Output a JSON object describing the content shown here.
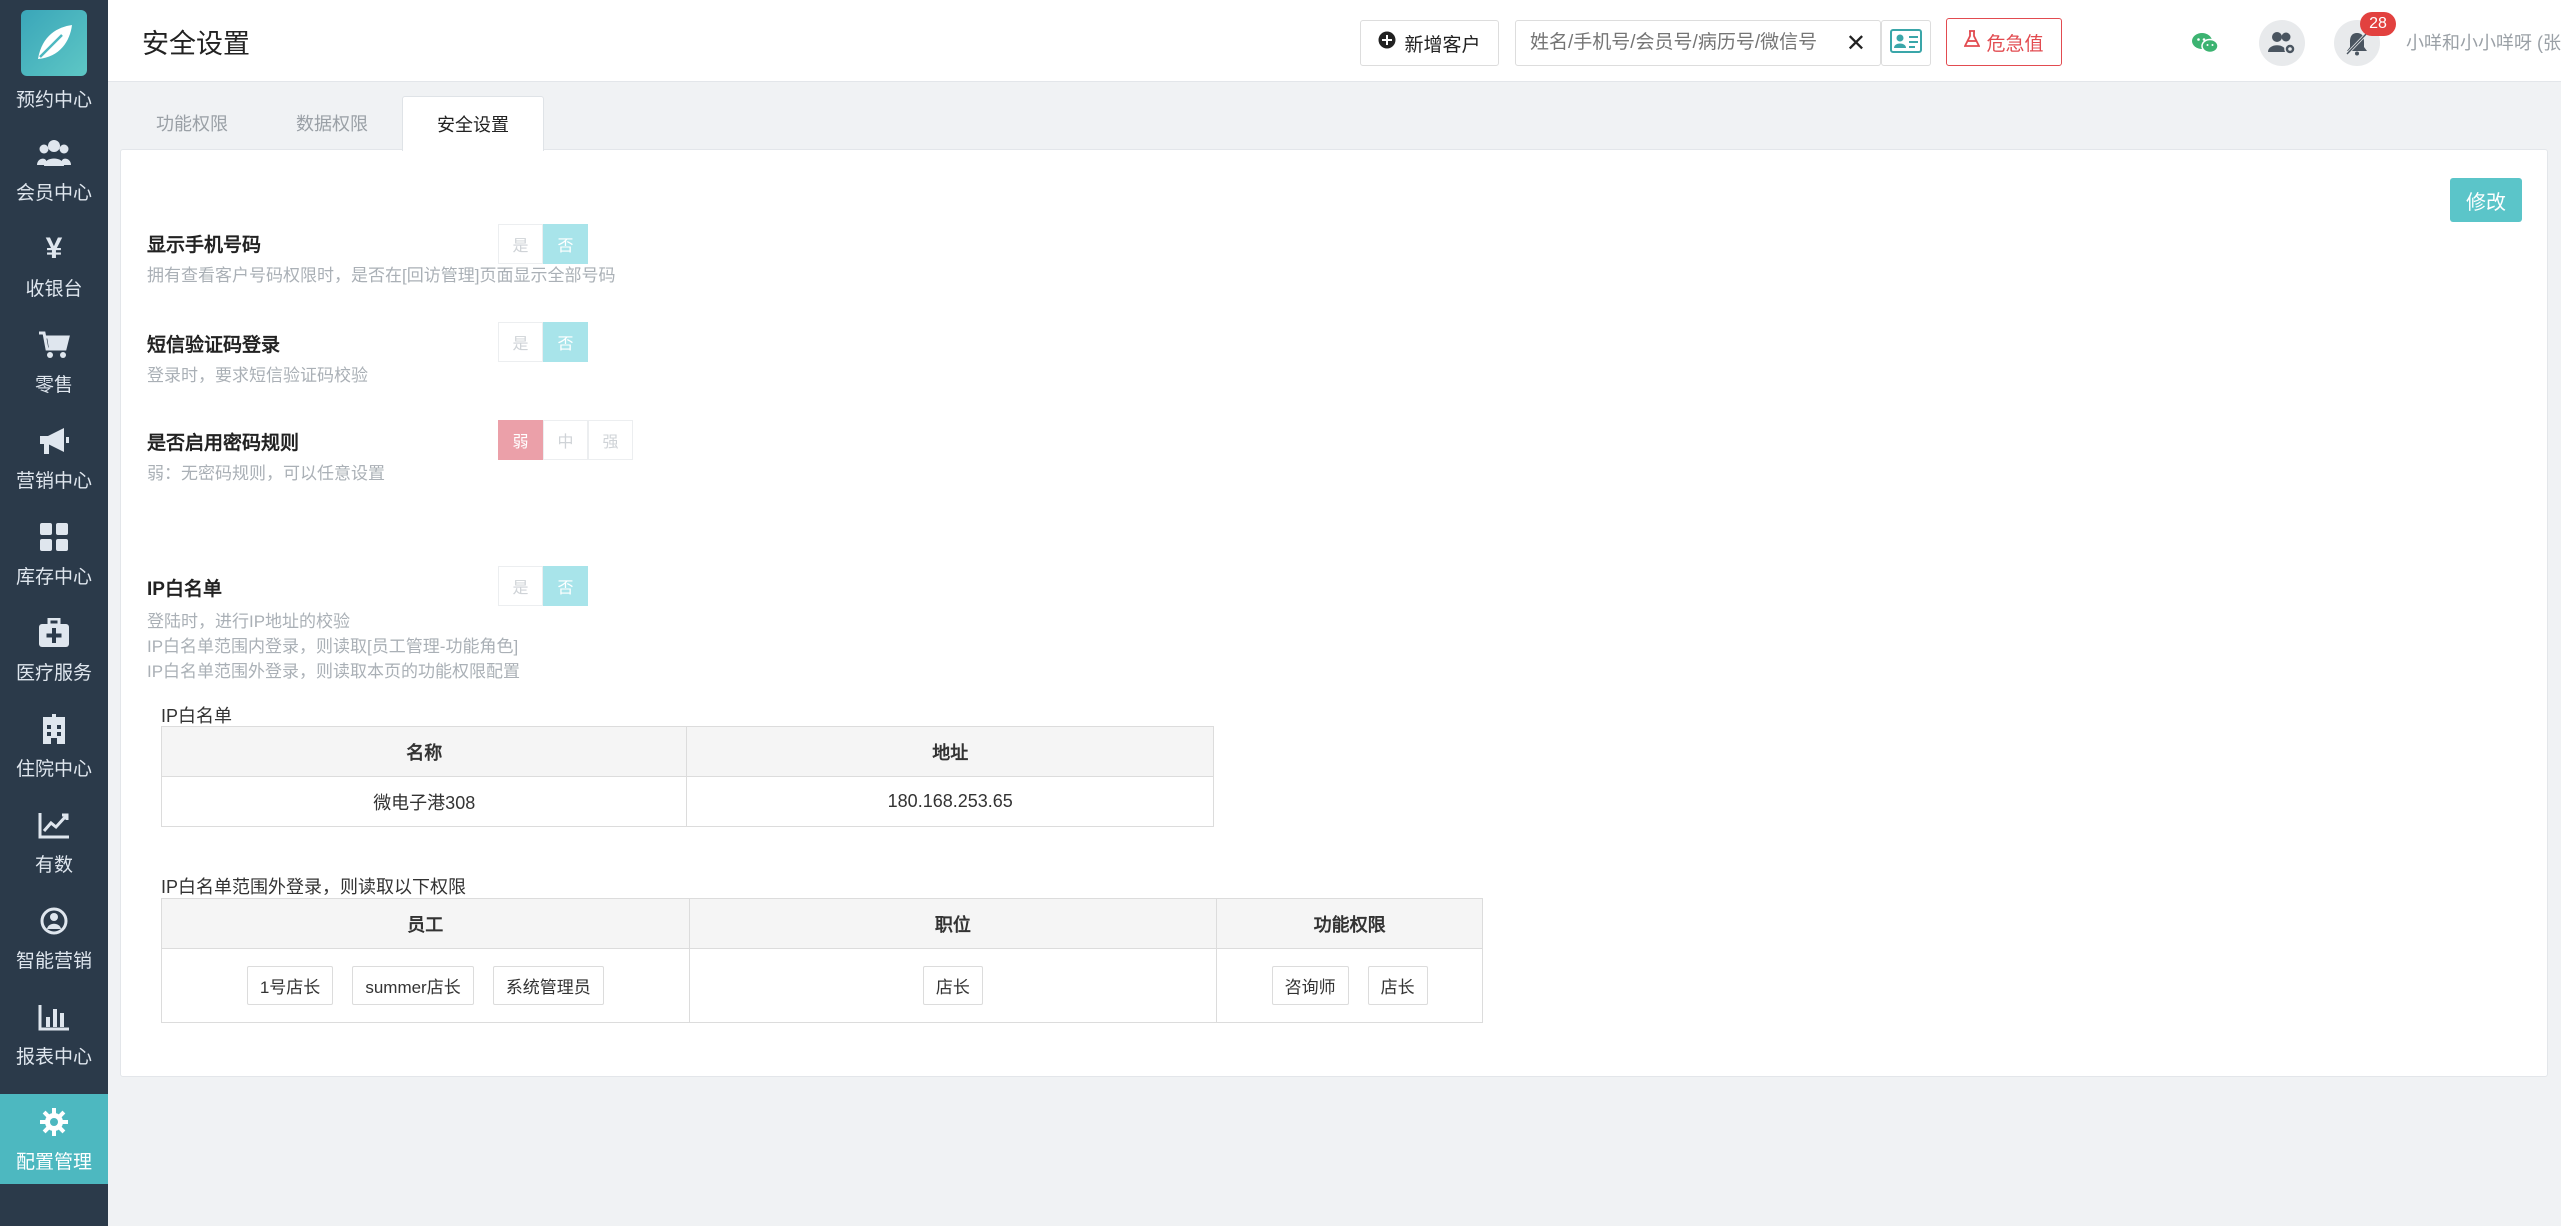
{
  "header": {
    "title": "安全设置",
    "new_customer_label": "新增客户",
    "search_placeholder": "姓名/手机号/会员号/病历号/微信号",
    "clear_symbol": "✕",
    "danger_label": "危急值",
    "notification_count": "28",
    "user_label": "小咩和小小咩呀 (张江门诊部)"
  },
  "sidebar": {
    "items": [
      {
        "label": "预约中心",
        "icon": "calendar-icon"
      },
      {
        "label": "会员中心",
        "icon": "users-icon"
      },
      {
        "label": "收银台",
        "icon": "yen-icon"
      },
      {
        "label": "零售",
        "icon": "cart-icon"
      },
      {
        "label": "营销中心",
        "icon": "megaphone-icon"
      },
      {
        "label": "库存中心",
        "icon": "grid-icon"
      },
      {
        "label": "医疗服务",
        "icon": "medkit-icon"
      },
      {
        "label": "住院中心",
        "icon": "building-icon"
      },
      {
        "label": "有数",
        "icon": "trend-icon"
      },
      {
        "label": "智能营销",
        "icon": "smart-icon"
      },
      {
        "label": "报表中心",
        "icon": "barchart-icon"
      },
      {
        "label": "配置管理",
        "icon": "gear-icon"
      }
    ]
  },
  "tabs": [
    {
      "label": "功能权限"
    },
    {
      "label": "数据权限"
    },
    {
      "label": "安全设置"
    }
  ],
  "panel": {
    "edit_label": "修改",
    "settings": {
      "phone": {
        "label": "显示手机号码",
        "desc": "拥有查看客户号码权限时，是否在[回访管理]页面显示全部号码",
        "options": [
          "是",
          "否"
        ]
      },
      "sms": {
        "label": "短信验证码登录",
        "desc": "登录时，要求短信验证码校验",
        "options": [
          "是",
          "否"
        ]
      },
      "password": {
        "label": "是否启用密码规则",
        "desc": "弱：无密码规则，可以任意设置",
        "options": [
          "弱",
          "中",
          "强"
        ]
      },
      "ip": {
        "label": "IP白名单",
        "desc1": "登陆时，进行IP地址的校验",
        "desc2": "IP白名单范围内登录，则读取[员工管理-功能角色]",
        "desc3": "IP白名单范围外登录，则读取本页的功能权限配置",
        "options": [
          "是",
          "否"
        ]
      }
    },
    "whitelist": {
      "caption": "IP白名单",
      "headers": [
        "名称",
        "地址"
      ],
      "row": {
        "name": "微电子港308",
        "address": "180.168.253.65"
      }
    },
    "outside": {
      "caption": "IP白名单范围外登录，则读取以下权限",
      "headers": [
        "员工",
        "职位",
        "功能权限"
      ],
      "staff": [
        "1号店长",
        "summer店长",
        "系统管理员"
      ],
      "position": [
        "店长"
      ],
      "permissions": [
        "咨询师",
        "店长"
      ]
    }
  },
  "colors": {
    "sidebar_bg": "#2b3a4a",
    "accent": "#5bc5c9",
    "danger": "#e24b50",
    "toggle_on": "#a8e4ea",
    "toggle_weak": "#eba0a9"
  }
}
